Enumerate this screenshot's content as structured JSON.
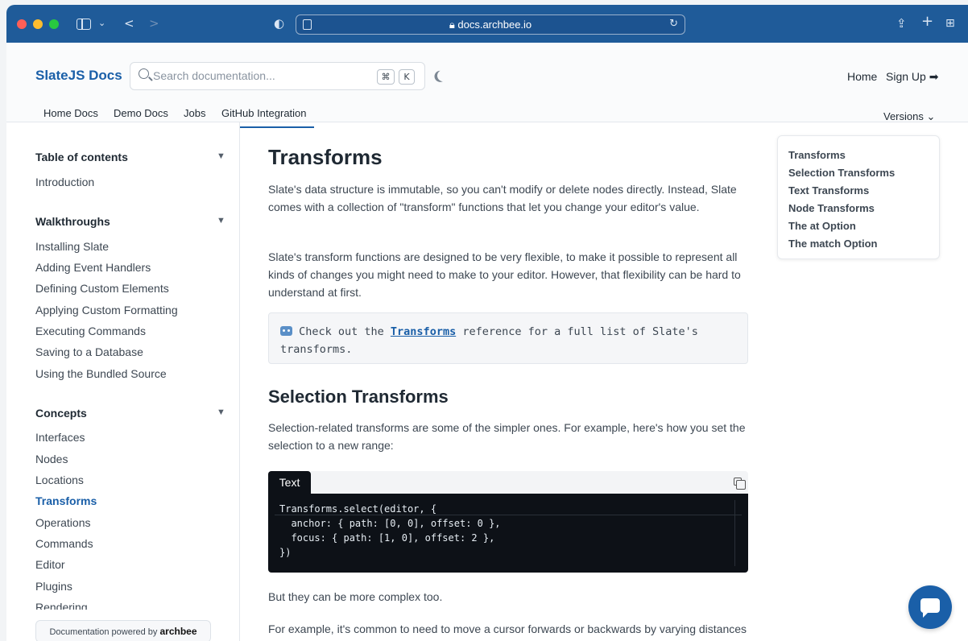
{
  "browser": {
    "url": "docs.archbee.io",
    "back_icon": "<",
    "forward_icon": ">",
    "chrome_color": "#1f5b99"
  },
  "header": {
    "brand": "SlateJS Docs",
    "search_placeholder": "Search documentation...",
    "shortcut_key1": "⌘",
    "shortcut_key2": "K",
    "nav_home": "Home",
    "nav_signup": "Sign Up ➡",
    "tabs": [
      "Home Docs",
      "Demo Docs",
      "Jobs",
      "GitHub Integration"
    ],
    "active_tab": "GitHub Integration",
    "versions": "Versions ⌄",
    "accent": "#1a5fa8"
  },
  "sidebar": {
    "sections": [
      {
        "title": "Table of contents",
        "items": [
          "Introduction"
        ]
      },
      {
        "title": "Walkthroughs",
        "items": [
          "Installing Slate",
          "Adding Event Handlers",
          "Defining Custom Elements",
          "Applying Custom Formatting",
          "Executing Commands",
          "Saving to a Database",
          "Using the Bundled Source"
        ]
      },
      {
        "title": "Concepts",
        "items": [
          "Interfaces",
          "Nodes",
          "Locations",
          "Transforms",
          "Operations",
          "Commands",
          "Editor",
          "Plugins",
          "Rendering"
        ]
      }
    ],
    "active_item": "Transforms",
    "powered_prefix": "Documentation powered by",
    "powered_brand": "archbee"
  },
  "content": {
    "title": "Transforms",
    "p1": "Slate's data structure is immutable, so you can't modify or delete nodes directly. Instead, Slate comes with a collection of \"transform\" functions that let you change your editor's value.",
    "p2": "Slate's transform functions are designed to be very flexible, to make it possible to represent all kinds of changes you might need to make to your editor. However, that flexibility can be hard to understand at first.",
    "note_before": " Check out the ",
    "note_link": "Transforms",
    "note_after": " reference for a full list of Slate's transforms.",
    "h2": "Selection Transforms",
    "p3": "Selection-related transforms are some of the simpler ones. For example, here's how you set the selection to a new range:",
    "code_lang": "Text",
    "code": "Transforms.select(editor, {\n  anchor: { path: [0, 0], offset: 0 },\n  focus: { path: [1, 0], offset: 2 },\n})",
    "p4": "But they can be more complex too.",
    "p5": "For example, it's common to need to move a cursor forwards or backwards by varying distances—by character, by word, by line. Here's how you'd move the cursor backwards by"
  },
  "toc": [
    "Transforms",
    "Selection Transforms",
    "Text Transforms",
    "Node Transforms",
    "The at Option",
    "The match Option"
  ]
}
